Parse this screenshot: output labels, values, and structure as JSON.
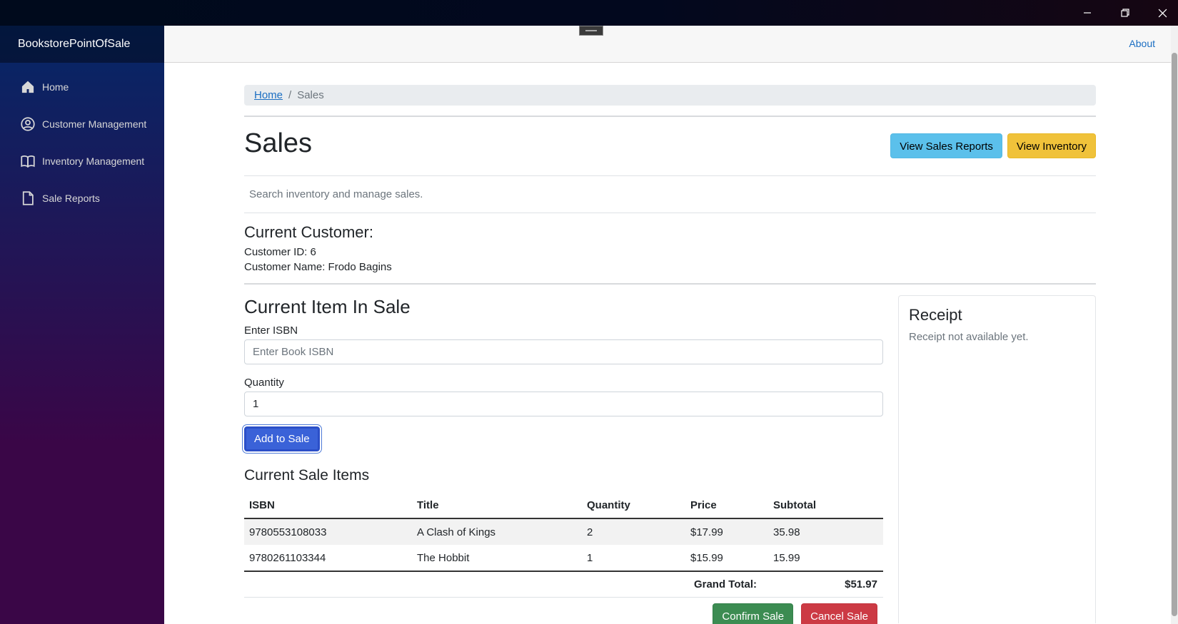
{
  "window": {
    "controls": {
      "minimize": "minimize-icon",
      "restore": "restore-icon",
      "close": "close-icon"
    }
  },
  "sidebar": {
    "brand": "BookstorePointOfSale",
    "items": [
      {
        "label": "Home",
        "icon": "home-icon"
      },
      {
        "label": "Customer Management",
        "icon": "user-circle-icon"
      },
      {
        "label": "Inventory Management",
        "icon": "book-icon"
      },
      {
        "label": "Sale Reports",
        "icon": "file-icon"
      }
    ]
  },
  "topbar": {
    "about": "About"
  },
  "breadcrumb": {
    "home": "Home",
    "separator": "/",
    "current": "Sales"
  },
  "page": {
    "title": "Sales",
    "subtitle": "Search inventory and manage sales.",
    "buttons": {
      "reports": "View Sales Reports",
      "inventory": "View Inventory"
    }
  },
  "customer": {
    "heading": "Current Customer:",
    "id_line": "Customer ID: 6",
    "name_line": "Customer Name: Frodo Bagins"
  },
  "current_item": {
    "heading": "Current Item In Sale",
    "isbn_label": "Enter ISBN",
    "isbn_placeholder": "Enter Book ISBN",
    "isbn_value": "",
    "quantity_label": "Quantity",
    "quantity_value": "1",
    "add_button": "Add to Sale"
  },
  "sale_items": {
    "heading": "Current Sale Items",
    "columns": [
      "ISBN",
      "Title",
      "Quantity",
      "Price",
      "Subtotal"
    ],
    "rows": [
      [
        "9780553108033",
        "A Clash of Kings",
        "2",
        "$17.99",
        "35.98"
      ],
      [
        "9780261103344",
        "The Hobbit",
        "1",
        "$15.99",
        "15.99"
      ]
    ],
    "grand_total_label": "Grand Total:",
    "grand_total_value": "$51.97"
  },
  "actions": {
    "confirm": "Confirm Sale",
    "cancel": "Cancel Sale"
  },
  "receipt": {
    "title": "Receipt",
    "text": "Receipt not available yet."
  },
  "colors": {
    "sidebar_top": "#052767",
    "sidebar_bottom": "#3a0647",
    "link": "#1b6ec2",
    "info": "#5bc0eb",
    "warning": "#f0c23a",
    "primary": "#3a62d8",
    "success": "#3c8c52",
    "danger": "#cc3a44"
  }
}
